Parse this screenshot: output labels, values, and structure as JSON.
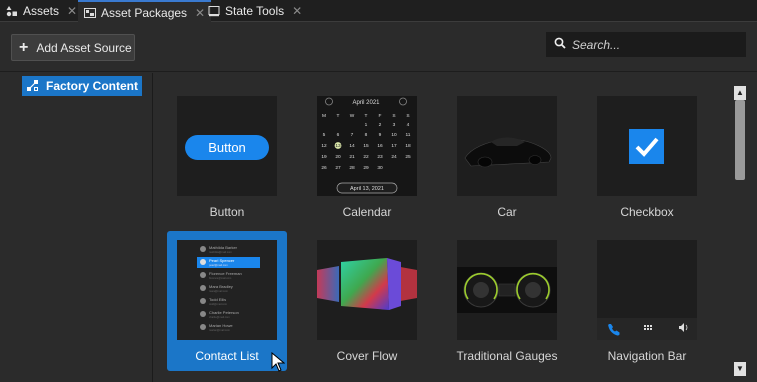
{
  "tabs": [
    {
      "label": "Assets",
      "icon": "assets-icon"
    },
    {
      "label": "Asset Packages",
      "icon": "packages-icon"
    },
    {
      "label": "State Tools",
      "icon": "window-icon"
    }
  ],
  "toolbar": {
    "add_label": "Add Asset Source",
    "search_placeholder": "Search..."
  },
  "sidebar": {
    "items": [
      {
        "label": "Factory Content",
        "icon": "factory-content-icon"
      }
    ]
  },
  "assets": [
    {
      "label": "Button",
      "thumb_text": "Button"
    },
    {
      "label": "Calendar",
      "month": "April 2021",
      "days_header": [
        "M",
        "T",
        "W",
        "T",
        "F",
        "S",
        "S"
      ],
      "date_field": "April 13, 2021"
    },
    {
      "label": "Car"
    },
    {
      "label": "Checkbox"
    },
    {
      "label": "Contact List",
      "selected": true,
      "contacts": [
        "Mathilda Barker",
        "Pearl Spencer",
        "Florence Freeman",
        "Mara Bradley",
        "Todd Ellis",
        "Charlie Peterson",
        "Marian Howe"
      ]
    },
    {
      "label": "Cover Flow"
    },
    {
      "label": "Traditional Gauges"
    },
    {
      "label": "Navigation Bar"
    }
  ],
  "colors": {
    "accent": "#1b76c8",
    "background": "#2b2b2b"
  }
}
